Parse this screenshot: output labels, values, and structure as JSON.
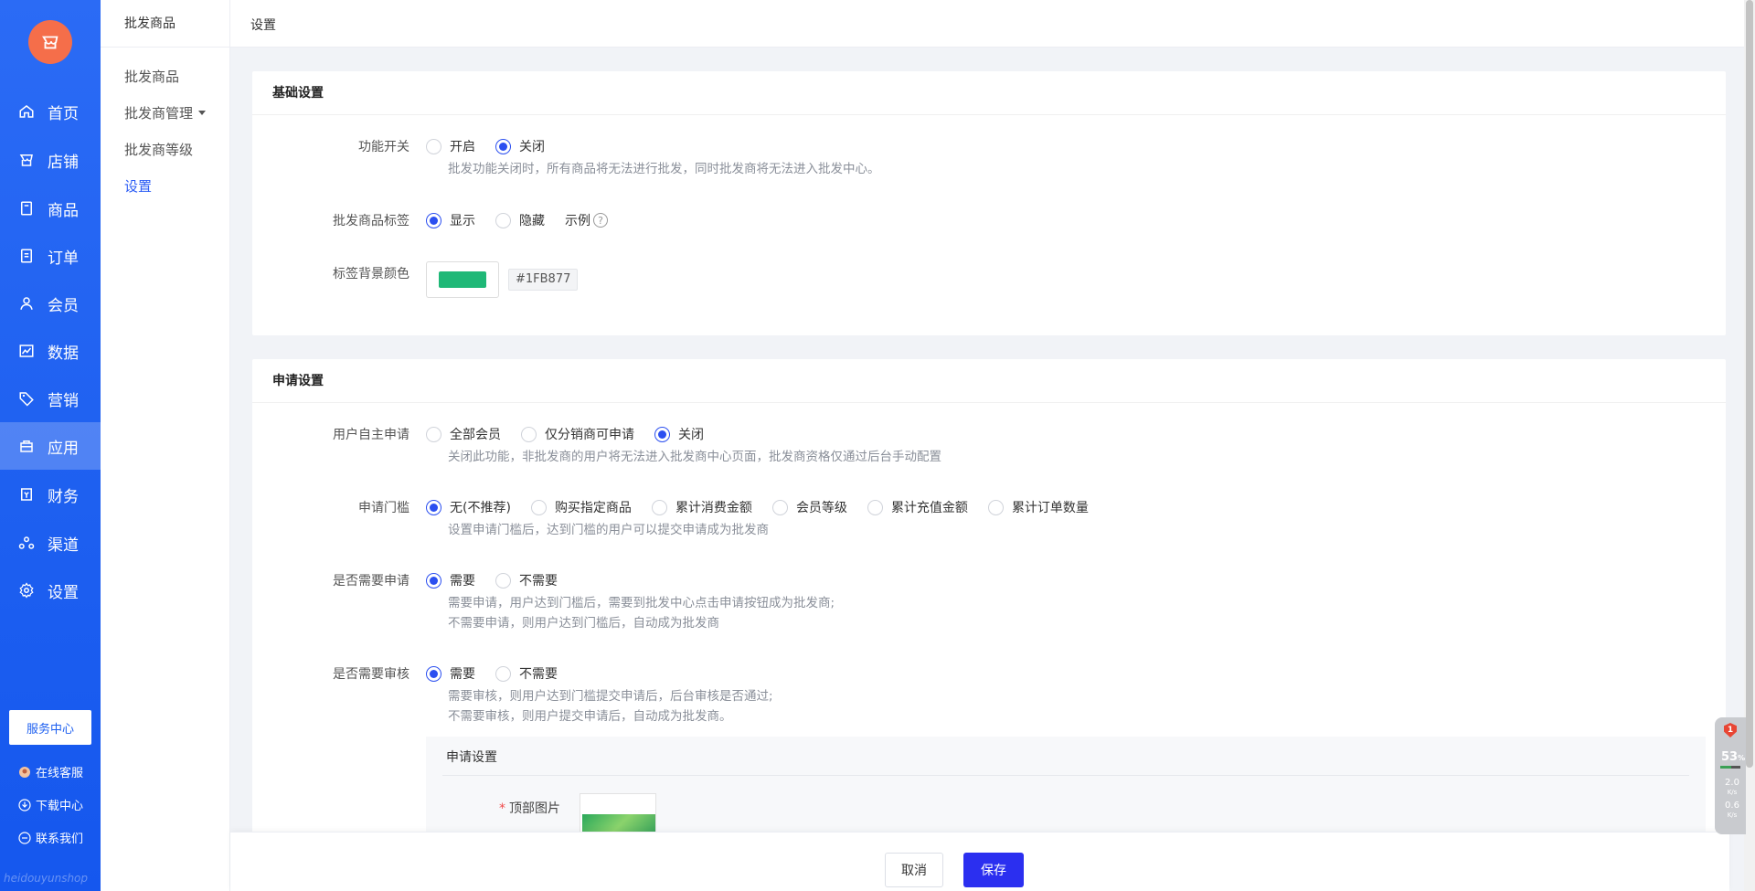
{
  "nav": {
    "items": [
      {
        "label": "首页",
        "icon": "home-icon"
      },
      {
        "label": "店铺",
        "icon": "store-icon"
      },
      {
        "label": "商品",
        "icon": "goods-icon"
      },
      {
        "label": "订单",
        "icon": "order-icon"
      },
      {
        "label": "会员",
        "icon": "member-icon"
      },
      {
        "label": "数据",
        "icon": "chart-icon"
      },
      {
        "label": "营销",
        "icon": "tag-icon"
      },
      {
        "label": "应用",
        "icon": "app-icon"
      },
      {
        "label": "财务",
        "icon": "finance-icon"
      },
      {
        "label": "渠道",
        "icon": "channel-icon"
      },
      {
        "label": "设置",
        "icon": "gear-icon"
      }
    ],
    "active": "应用",
    "service_center": "服务中心",
    "links": [
      "在线客服",
      "下载中心",
      "联系我们"
    ],
    "watermark": "heidouyunshop"
  },
  "subnav": {
    "title": "批发商品",
    "items": [
      "批发商品",
      "批发商管理",
      "批发商等级",
      "设置"
    ],
    "active": "设置"
  },
  "breadcrumb": "设置",
  "basic": {
    "title": "基础设置",
    "feature_switch": {
      "label": "功能开关",
      "options": [
        "开启",
        "关闭"
      ],
      "selected": "关闭",
      "help": "批发功能关闭时，所有商品将无法进行批发，同时批发商将无法进入批发中心。"
    },
    "goods_tag": {
      "label": "批发商品标签",
      "options": [
        "显示",
        "隐藏"
      ],
      "selected": "显示",
      "example": "示例"
    },
    "tag_bg": {
      "label": "标签背景颜色",
      "color": "#1FB877",
      "hex": "#1FB877"
    }
  },
  "apply": {
    "title": "申请设置",
    "self_apply": {
      "label": "用户自主申请",
      "options": [
        "全部会员",
        "仅分销商可申请",
        "关闭"
      ],
      "selected": "关闭",
      "help": "关闭此功能，非批发商的用户将无法进入批发商中心页面，批发商资格仅通过后台手动配置"
    },
    "threshold": {
      "label": "申请门槛",
      "options": [
        "无(不推荐)",
        "购买指定商品",
        "累计消费金额",
        "会员等级",
        "累计充值金额",
        "累计订单数量"
      ],
      "selected": "无(不推荐)",
      "help": "设置申请门槛后，达到门槛的用户可以提交申请成为批发商"
    },
    "need_apply": {
      "label": "是否需要申请",
      "options": [
        "需要",
        "不需要"
      ],
      "selected": "需要",
      "help1": "需要申请，用户达到门槛后，需要到批发中心点击申请按钮成为批发商;",
      "help2": "不需要申请，则用户达到门槛后，自动成为批发商"
    },
    "need_review": {
      "label": "是否需要审核",
      "options": [
        "需要",
        "不需要"
      ],
      "selected": "需要",
      "help1": "需要审核，则用户达到门槛提交申请后，后台审核是否通过;",
      "help2": "不需要审核，则用户提交申请后，自动成为批发商。"
    },
    "inner": {
      "title": "申请设置",
      "top_image_label": "顶部图片",
      "required_mark": "*"
    }
  },
  "footer": {
    "cancel": "取消",
    "save": "保存"
  },
  "monitor": {
    "badge": "1",
    "cpu_percent": "53",
    "cpu_unit": "%",
    "cpu_level": 0.53,
    "up_speed": "2.0",
    "down_speed": "0.6",
    "speed_unit": "K/s"
  },
  "colors": {
    "primary": "#2b4ff0",
    "nav_bg": "#1d5ff0",
    "logo": "#f56e4a"
  }
}
